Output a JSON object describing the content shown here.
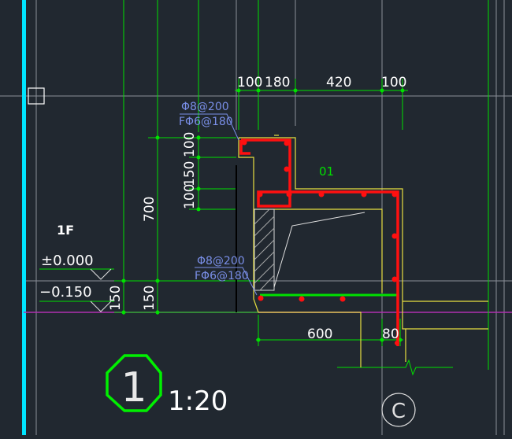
{
  "dimensions": {
    "top": [
      "100",
      "180",
      "420",
      "100"
    ],
    "left_stack": [
      "100",
      "150",
      "100"
    ],
    "height_700": "700",
    "slab_left": "150",
    "slab_inner": "150",
    "bottom": [
      "600",
      "80"
    ]
  },
  "rebar_notes": {
    "top_line1": "Φ8@200",
    "top_line2": "FΦ6@180",
    "mid_line1": "Φ8@200",
    "mid_line2": "FΦ6@180"
  },
  "labels": {
    "floor": "1F",
    "elev_main": "±0.000",
    "elev_low": "−0.150",
    "tag": "01",
    "axis": "C",
    "detail_number": "1",
    "scale": "1:20"
  },
  "colors": {
    "background": "#212830",
    "cyan": "#00e5ff",
    "green": "#00e000",
    "red": "#ff1010",
    "yellow": "#e8e040",
    "blue": "#7a8fe8",
    "magenta": "#b030b0"
  }
}
